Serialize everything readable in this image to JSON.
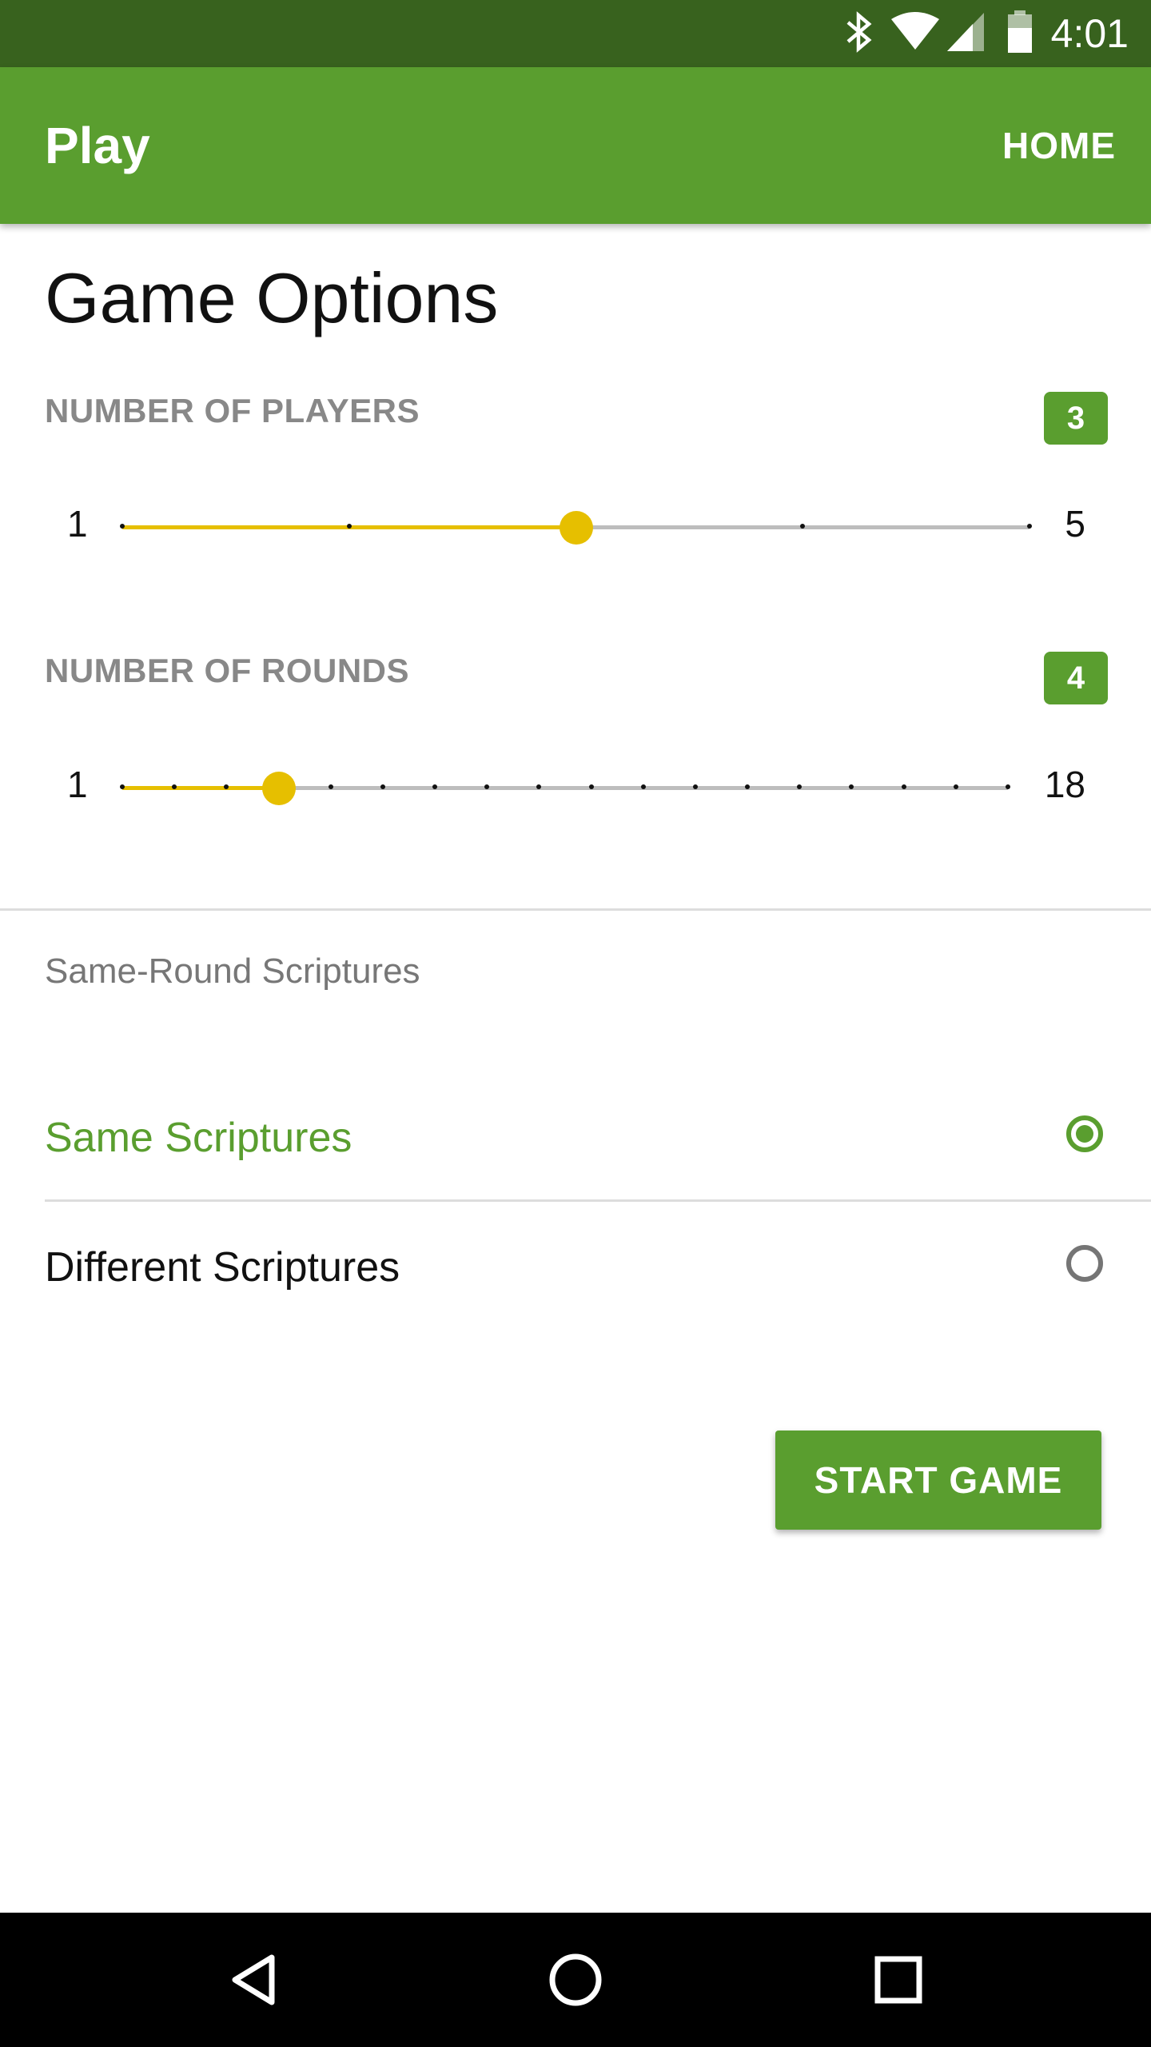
{
  "status_bar": {
    "time": "4:01",
    "icons": [
      "bluetooth-icon",
      "wifi-icon",
      "cell-signal-icon",
      "battery-icon"
    ],
    "background": "#38621e"
  },
  "app_bar": {
    "title": "Play",
    "home_label": "HOME",
    "background": "#5a9e2f"
  },
  "page": {
    "title": "Game Options"
  },
  "players": {
    "label": "NUMBER OF PLAYERS",
    "value": "3",
    "min": "1",
    "max": "5",
    "current": 3
  },
  "rounds": {
    "label": "NUMBER OF ROUNDS",
    "value": "4",
    "min": "1",
    "max": "18",
    "current": 4
  },
  "scripture_mode": {
    "header": "Same-Round Scriptures",
    "options": [
      {
        "label": "Same Scriptures",
        "selected": true
      },
      {
        "label": "Different Scriptures",
        "selected": false
      }
    ]
  },
  "start_button": {
    "label": "START GAME"
  },
  "nav_bar": {
    "icons": [
      "back-icon",
      "home-icon",
      "recents-icon"
    ]
  },
  "colors": {
    "accent": "#5a9e2f",
    "slider": "#e6bf00"
  }
}
